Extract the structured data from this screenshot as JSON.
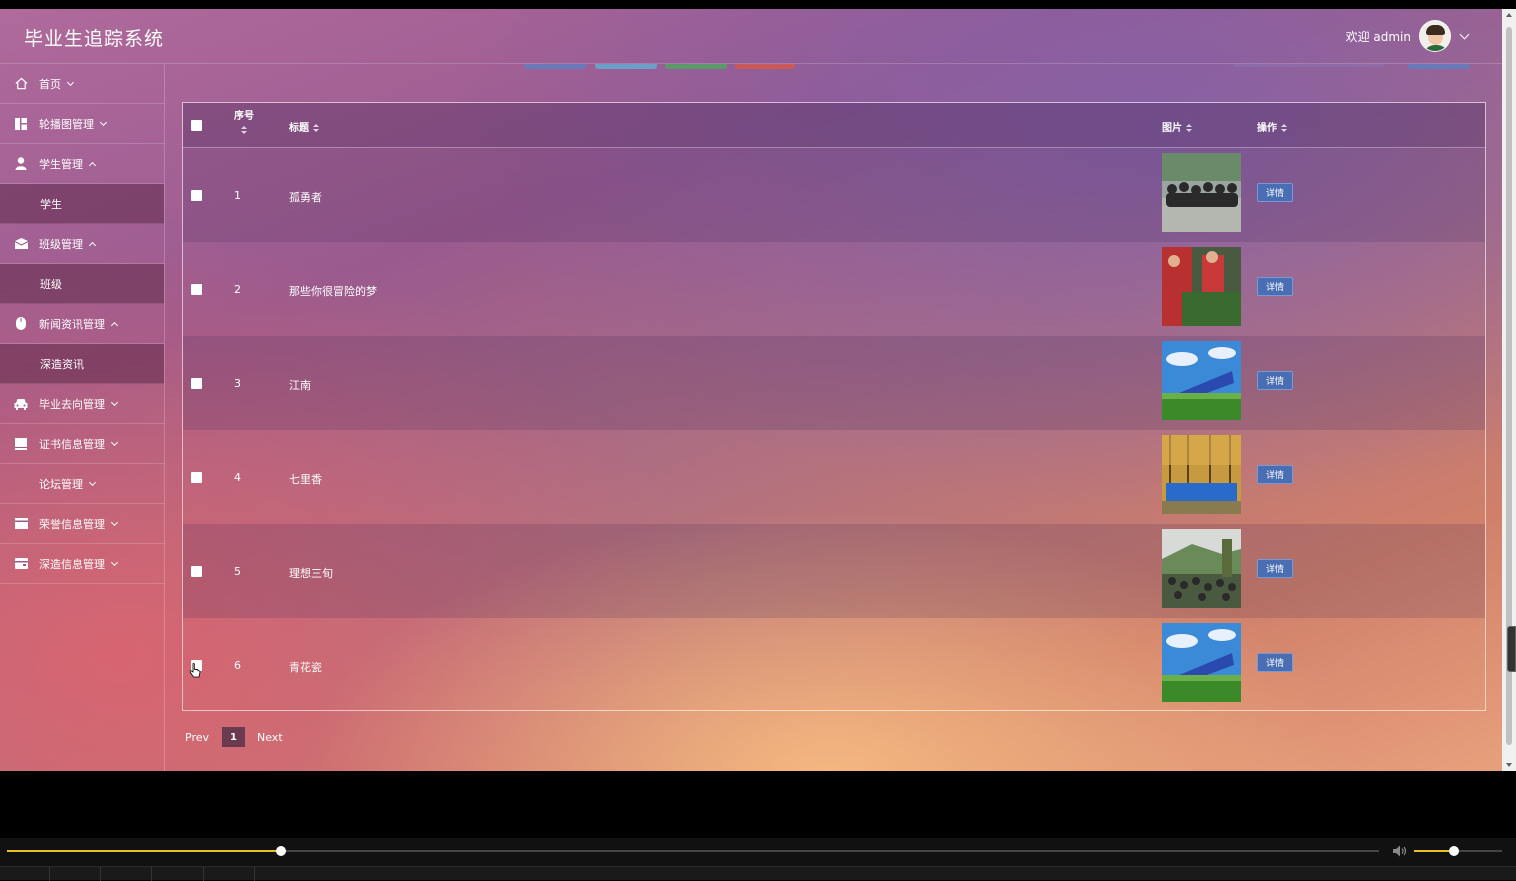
{
  "header": {
    "brand": "毕业生追踪系统",
    "welcome": "欢迎 admin"
  },
  "sidebar": {
    "items": [
      {
        "label": "首页",
        "icon": "home-icon",
        "expanded": false
      },
      {
        "label": "轮播图管理",
        "icon": "dashboard-icon",
        "expanded": false
      },
      {
        "label": "学生管理",
        "icon": "user-icon",
        "expanded": true,
        "children": [
          "学生"
        ]
      },
      {
        "label": "班级管理",
        "icon": "mail-icon",
        "expanded": true,
        "children": [
          "班级"
        ]
      },
      {
        "label": "新闻资讯管理",
        "icon": "mouse-icon",
        "expanded": true,
        "children": [
          "深造资讯"
        ]
      },
      {
        "label": "毕业去向管理",
        "icon": "car-icon",
        "expanded": false
      },
      {
        "label": "证书信息管理",
        "icon": "tablet-icon",
        "expanded": false
      },
      {
        "label": "论坛管理",
        "icon": "",
        "expanded": false
      },
      {
        "label": "荣誉信息管理",
        "icon": "card-icon",
        "expanded": false
      },
      {
        "label": "深造信息管理",
        "icon": "wallet-icon",
        "expanded": false
      }
    ]
  },
  "table": {
    "columns": {
      "index": "序号",
      "title": "标题",
      "image": "图片",
      "action": "操作"
    },
    "rows": [
      {
        "index": "1",
        "title": "孤勇者",
        "image": "group-photo-pavilion",
        "action": "详情"
      },
      {
        "index": "2",
        "title": "那些你很冒险的梦",
        "image": "volunteers-red-shirts",
        "action": "详情"
      },
      {
        "index": "3",
        "title": "江南",
        "image": "campus-sign-blue-sky",
        "action": "详情"
      },
      {
        "index": "4",
        "title": "七里香",
        "image": "autumn-forest-banner",
        "action": "详情"
      },
      {
        "index": "5",
        "title": "理想三旬",
        "image": "crowd-mountain",
        "action": "详情"
      },
      {
        "index": "6",
        "title": "青花瓷",
        "image": "campus-sign-blue-sky",
        "action": "详情"
      }
    ]
  },
  "pager": {
    "prev": "Prev",
    "current": "1",
    "next": "Next"
  },
  "player": {
    "progress": 0.2,
    "volume": 0.45,
    "accent": "#e8c020"
  },
  "colors": {
    "detail_button": "#4a6eb4",
    "pager_active": "#6a3a50"
  }
}
